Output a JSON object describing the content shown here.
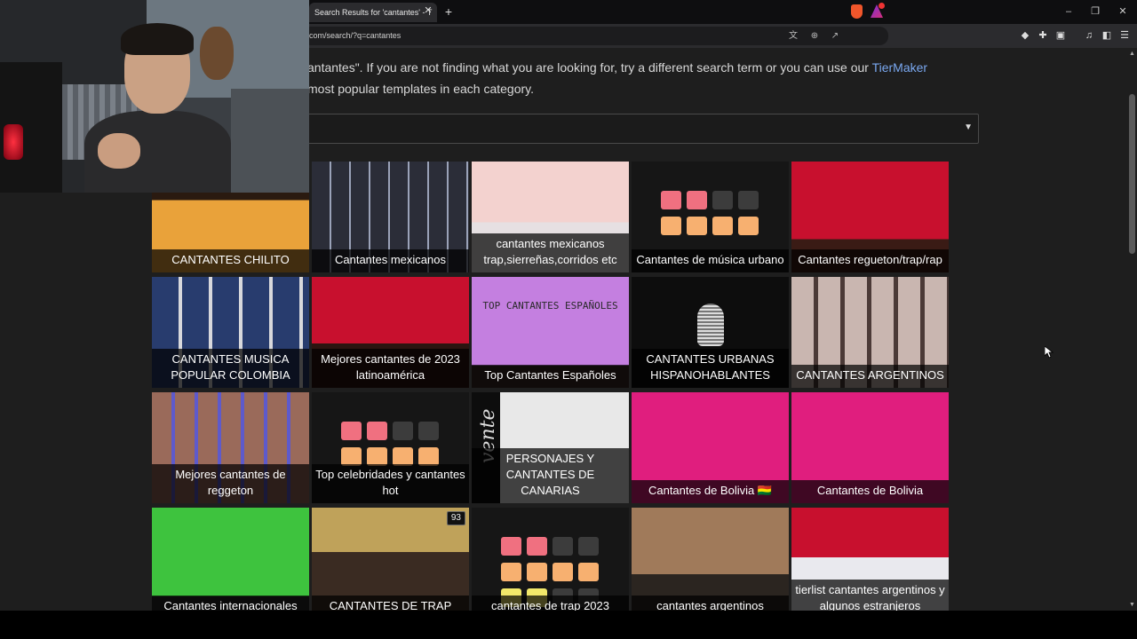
{
  "browser": {
    "tab_title": "Search Results for 'cantantes' - T",
    "tab_close": "✕",
    "new_tab": "+",
    "url": "com/search/?q=cantantes",
    "window": {
      "minimize": "–",
      "restore": "❐",
      "close": "✕"
    }
  },
  "intro": {
    "line1_prefix": "antantes\". If you are not finding what you are looking for, try a different search term or you can use our ",
    "link": "TierMaker",
    "line2": " most popular templates in each category."
  },
  "category_select": {
    "value": ""
  },
  "tiles": [
    {
      "caption": "CANTANTES CHILITO",
      "col": 0,
      "row": 0
    },
    {
      "caption": "Cantantes mexicanos",
      "col": 1,
      "row": 0
    },
    {
      "caption": "cantantes mexicanos trap,sierreñas,corridos etc",
      "col": 2,
      "row": 0
    },
    {
      "caption": "Cantantes de música urbano",
      "col": 3,
      "row": 0
    },
    {
      "caption": "Cantantes regueton/trap/rap",
      "col": 4,
      "row": 0
    },
    {
      "caption": "CANTANTES MUSICA POPULAR COLOMBIA",
      "col": 0,
      "row": 1
    },
    {
      "caption": "Mejores cantantes de 2023 latinoamérica",
      "col": 1,
      "row": 1
    },
    {
      "caption": "Top Cantantes Españoles",
      "col": 2,
      "row": 1,
      "thumb_text": "TOP CANTANTES ESPAÑOLES"
    },
    {
      "caption": "CANTANTES URBANAS HISPANOHABLANTES",
      "col": 3,
      "row": 1
    },
    {
      "caption": "CANTANTES ARGENTINOS",
      "col": 4,
      "row": 1
    },
    {
      "caption": "Mejores cantantes de reggeton",
      "col": 0,
      "row": 2
    },
    {
      "caption": "Top celebridades y cantantes hot",
      "col": 1,
      "row": 2
    },
    {
      "caption": "PERSONAJES Y CANTANTES DE CANARIAS",
      "col": 2,
      "row": 2,
      "thumb_text": "vente"
    },
    {
      "caption": "Cantantes de Bolivia 🇧🇴",
      "col": 3,
      "row": 2
    },
    {
      "caption": "Cantantes de Bolivia",
      "col": 4,
      "row": 2
    },
    {
      "caption": "Cantantes internacionales",
      "col": 0,
      "row": 3
    },
    {
      "caption": "CANTANTES DE TRAP",
      "col": 1,
      "row": 3,
      "badge": "93"
    },
    {
      "caption": "cantantes de trap 2023",
      "col": 2,
      "row": 3
    },
    {
      "caption": "cantantes argentinos",
      "col": 3,
      "row": 3
    },
    {
      "caption": "tierlist cantantes argentinos y algunos estranjeros",
      "col": 4,
      "row": 3
    }
  ],
  "colors": {
    "background": "#1e1e1e",
    "link": "#7aa8f0",
    "tier_red": "#f07080",
    "tier_orange": "#f7b070",
    "tier_yellow": "#f2e86a",
    "tier_gray": "#3c3c3c",
    "bolivia_pink": "#e01e7e"
  }
}
